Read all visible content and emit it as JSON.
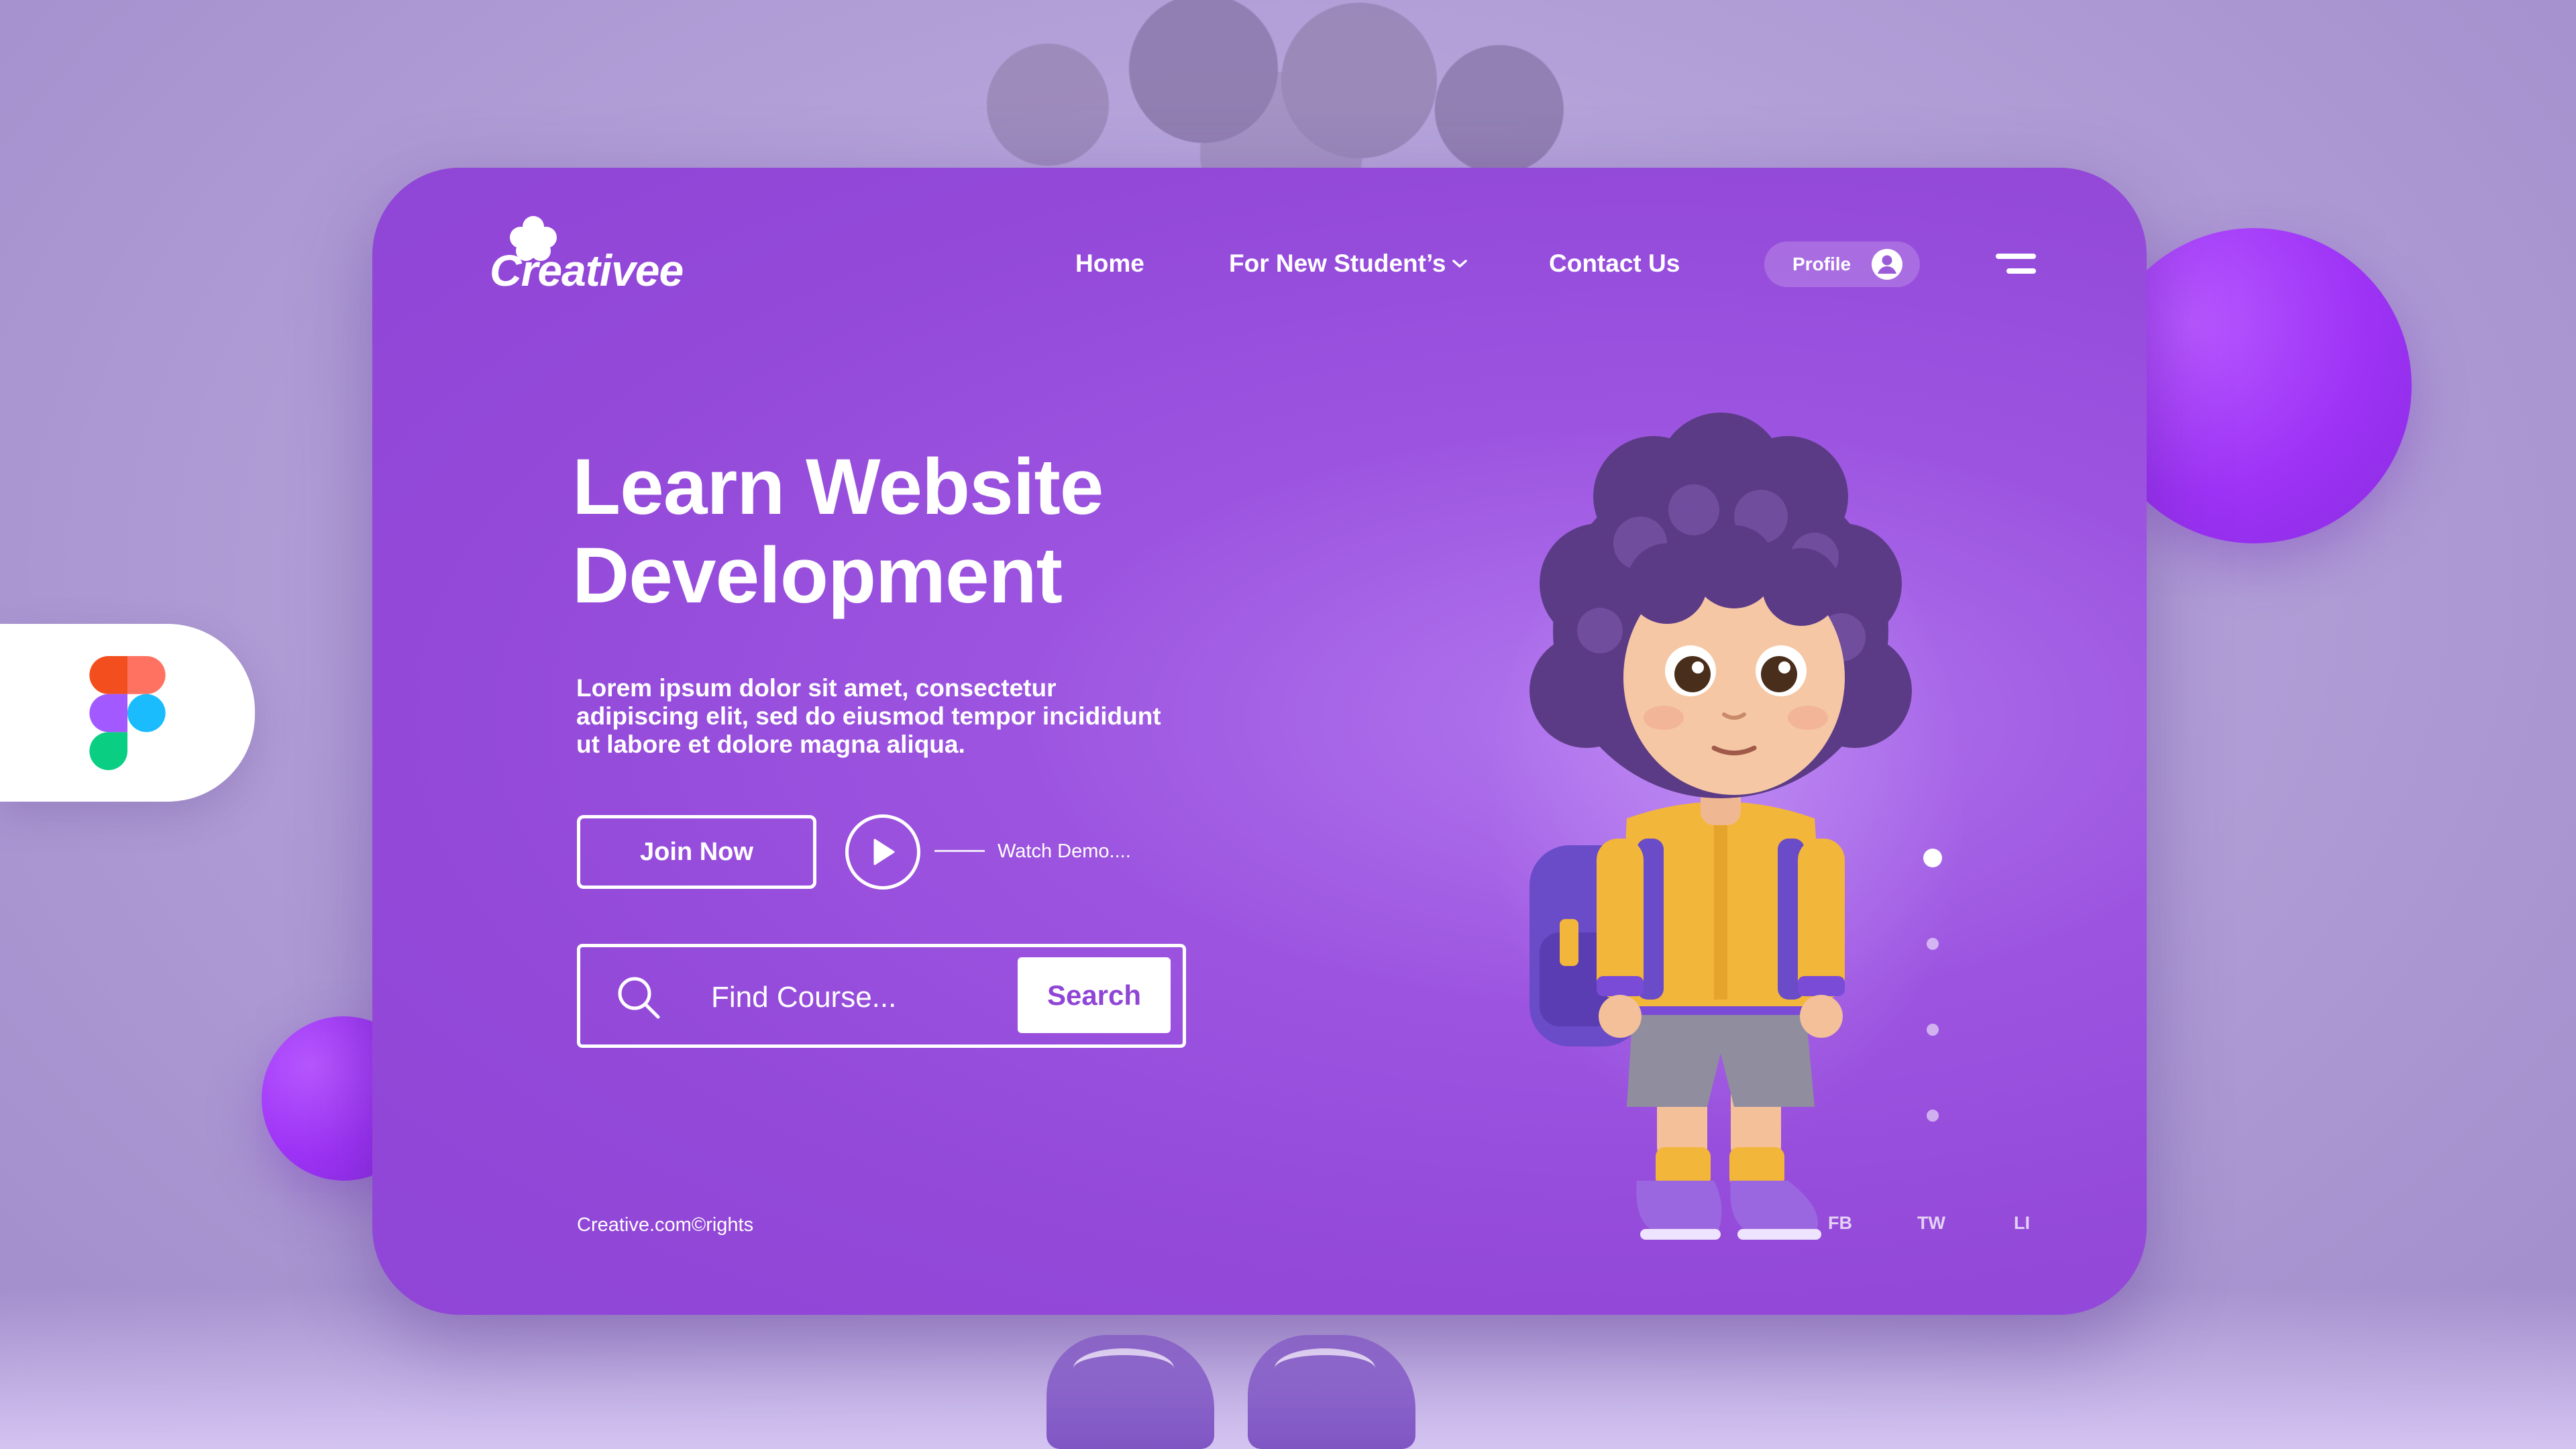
{
  "brand": {
    "name": "Creativee",
    "accent": "#9348d8",
    "accent_bright": "#a935ff"
  },
  "nav": {
    "home": "Home",
    "students": "For New Student’s",
    "contact": "Contact Us",
    "profile": "Profile"
  },
  "hero": {
    "title_line1": "Learn Website",
    "title_line2": "Development",
    "description": "Lorem ipsum dolor sit amet, consectetur adipiscing elit, sed do eiusmod tempor incididunt ut labore et dolore magna aliqua.",
    "join_label": "Join Now",
    "demo_label": "Watch Demo...."
  },
  "search": {
    "placeholder": "Find Course...",
    "button_label": "Search"
  },
  "slider": {
    "count": 4,
    "active": 1
  },
  "footer": {
    "copyright": "Creative.com©rights",
    "social": [
      "FB",
      "TW",
      "LI"
    ]
  },
  "icons": {
    "logo": "flower-icon",
    "profile": "user-circle-icon",
    "menu": "hamburger-icon",
    "play": "play-icon",
    "search": "search-icon",
    "dropdown": "chevron-down-icon",
    "app": "figma-icon"
  }
}
